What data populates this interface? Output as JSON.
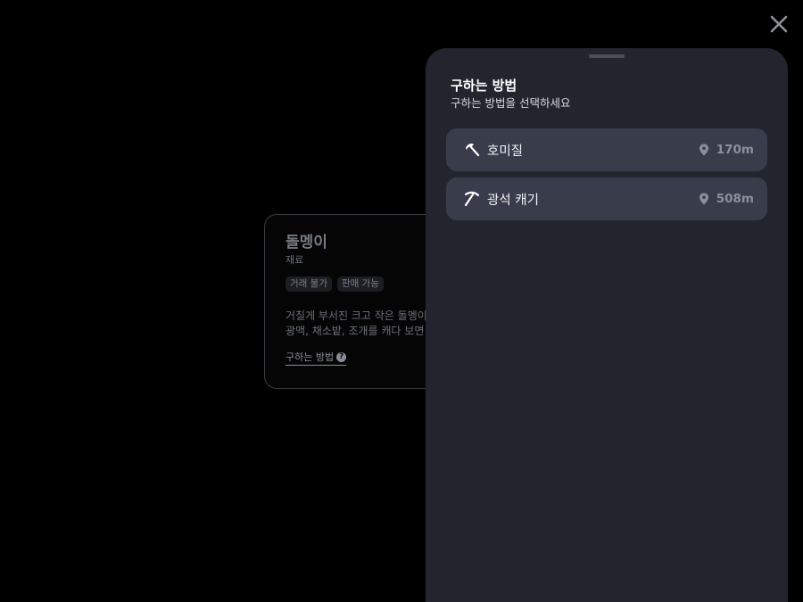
{
  "background_card": {
    "item_name": "돌멩이",
    "category": "재료",
    "tags": [
      "거래 불가",
      "판매 가능"
    ],
    "description_lines": [
      "거칠게 부서진 크고 작은 돌멩이",
      "광맥, 채소밭, 조개를 캐다 보면"
    ],
    "how_to_get_link": "구하는 방법",
    "help_icon_glyph": "?"
  },
  "sheet": {
    "title": "구하는 방법",
    "subtitle": "구하는 방법을 선택하세요",
    "options": [
      {
        "label": "호미질",
        "distance": "170m",
        "icon": "hoe-icon"
      },
      {
        "label": "광석 캐기",
        "distance": "508m",
        "icon": "pickaxe-icon"
      }
    ]
  },
  "close_icon": "close-icon",
  "colors": {
    "backdrop": "#000000",
    "sheet_bg": "#22252d",
    "option_bg": "#393c4b",
    "distance_text": "#8c909a"
  }
}
